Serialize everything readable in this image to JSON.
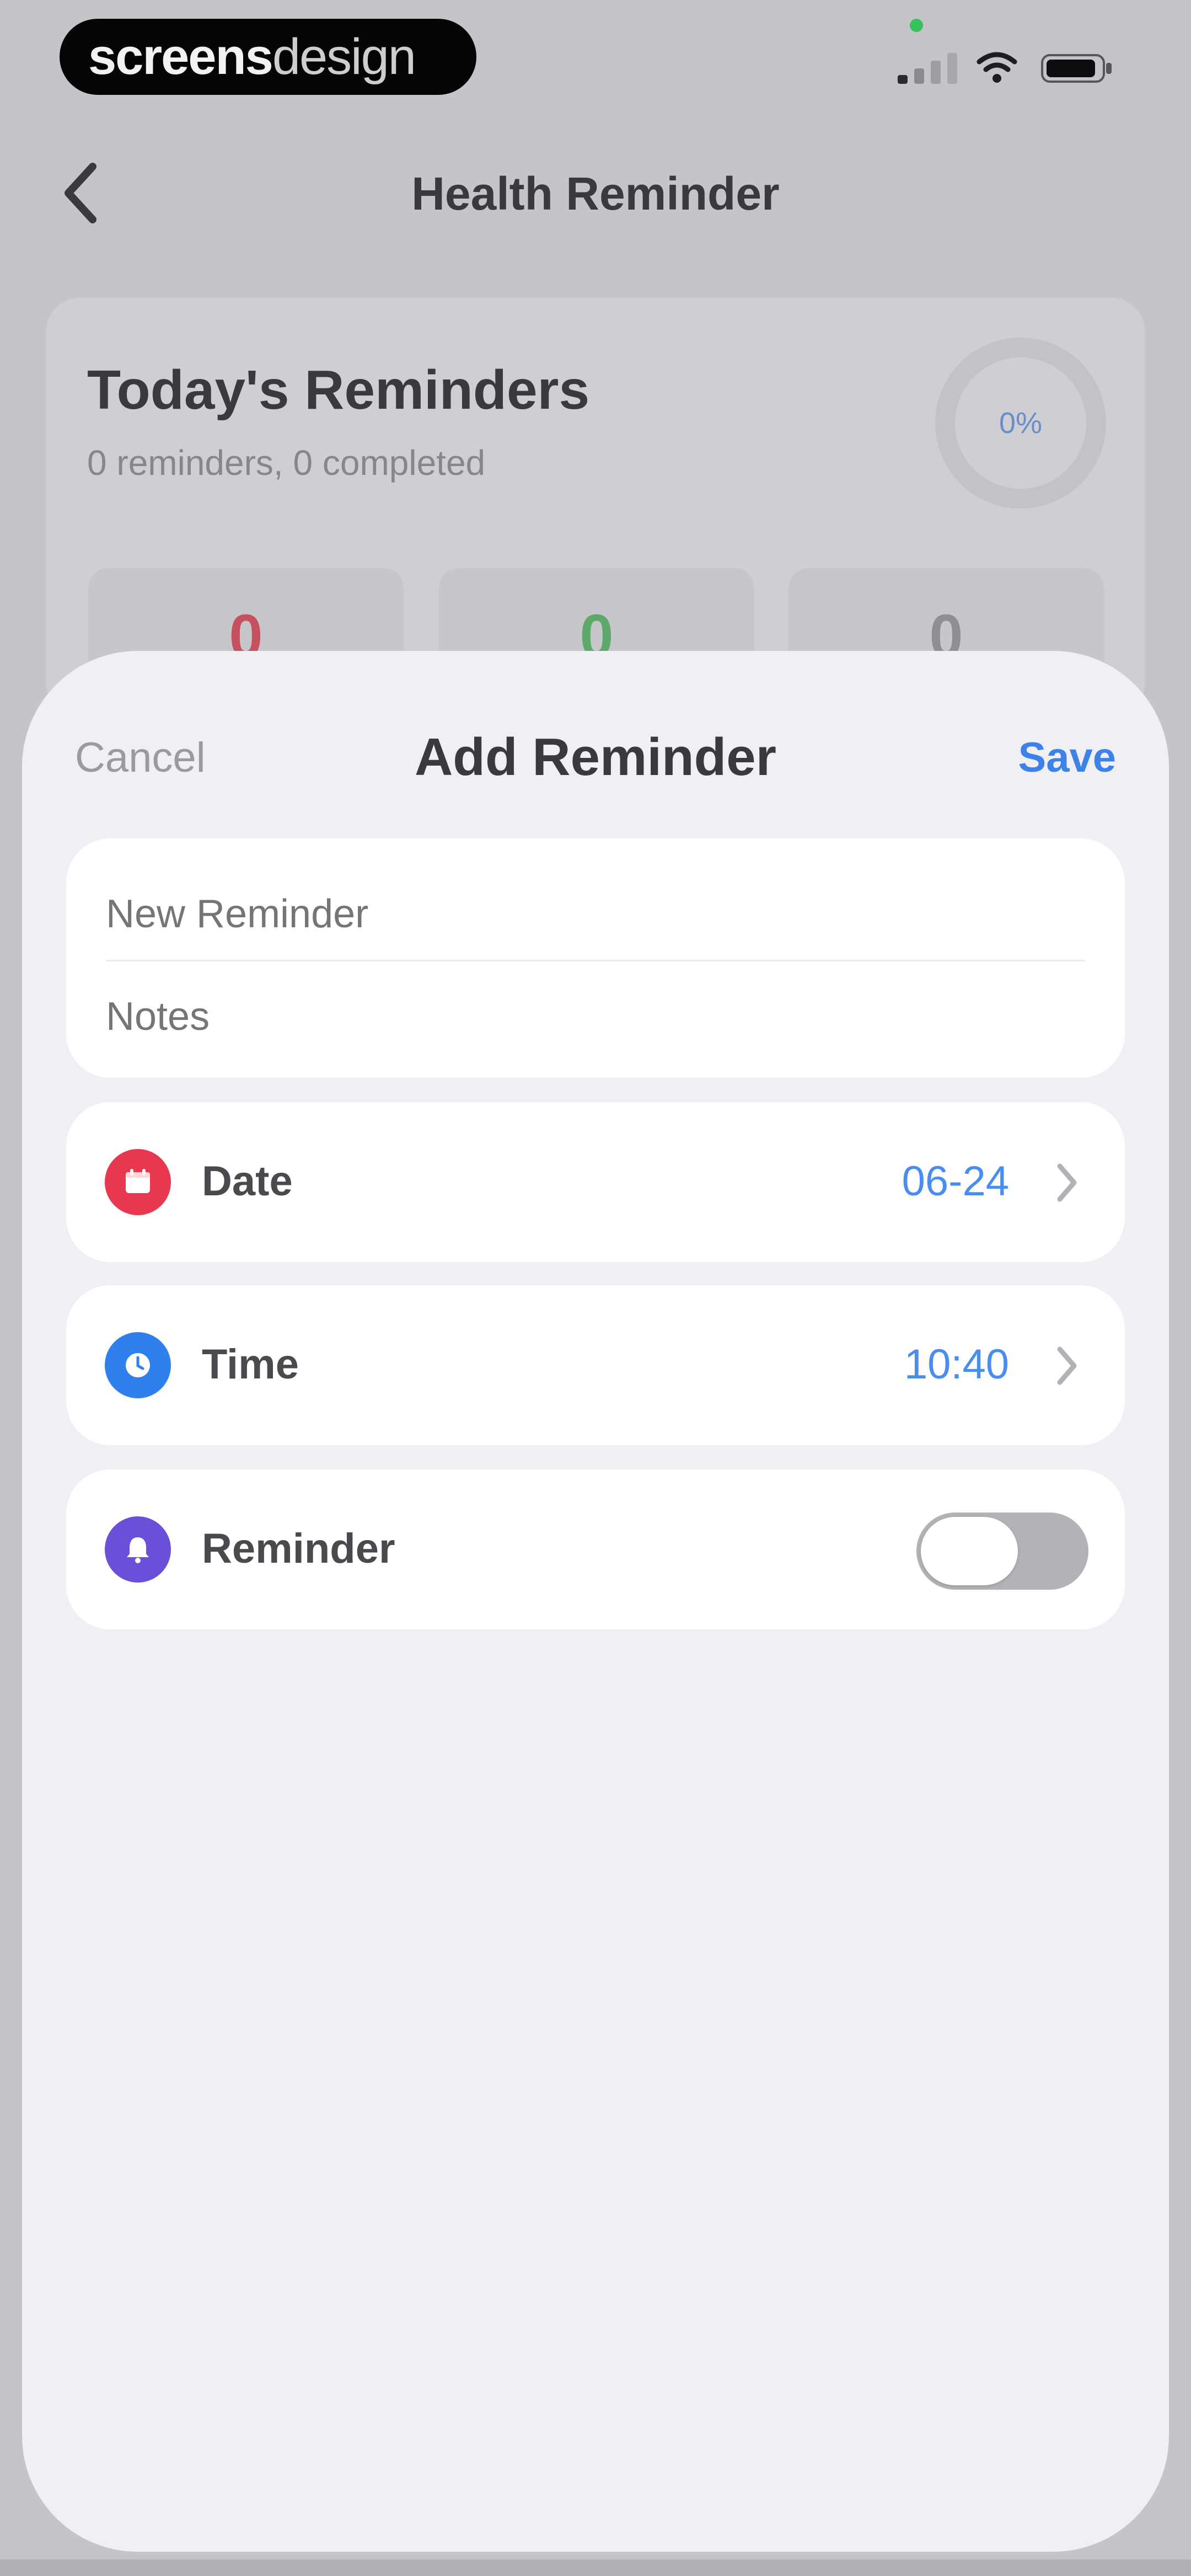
{
  "status_bar": {
    "brand_left": "screens",
    "brand_right": "design",
    "icons": [
      "cellular-signal-icon",
      "wifi-icon",
      "battery-icon"
    ]
  },
  "nav": {
    "back_icon": "chevron-left-icon",
    "title": "Health Reminder"
  },
  "summary": {
    "title": "Today's Reminders",
    "subtitle": "0 reminders, 0 completed",
    "progress_label": "0%",
    "progress": 0,
    "stats": [
      "0",
      "0",
      "0"
    ]
  },
  "sheet": {
    "cancel_label": "Cancel",
    "title": "Add Reminder",
    "save_label": "Save",
    "title_placeholder": "New Reminder",
    "notes_placeholder": "Notes",
    "rows": {
      "date": {
        "label": "Date",
        "value": "06-24",
        "icon": "calendar-icon",
        "icon_color": "#e8384f"
      },
      "time": {
        "label": "Time",
        "value": "10:40",
        "icon": "clock-icon",
        "icon_color": "#2f80ed"
      },
      "reminder": {
        "label": "Reminder",
        "icon": "bell-icon",
        "icon_color": "#6b4fd8",
        "enabled": false
      }
    }
  },
  "colors": {
    "accent": "#3c82e8",
    "value_blue": "#4a8df0",
    "sheet_bg": "#efeff4"
  }
}
